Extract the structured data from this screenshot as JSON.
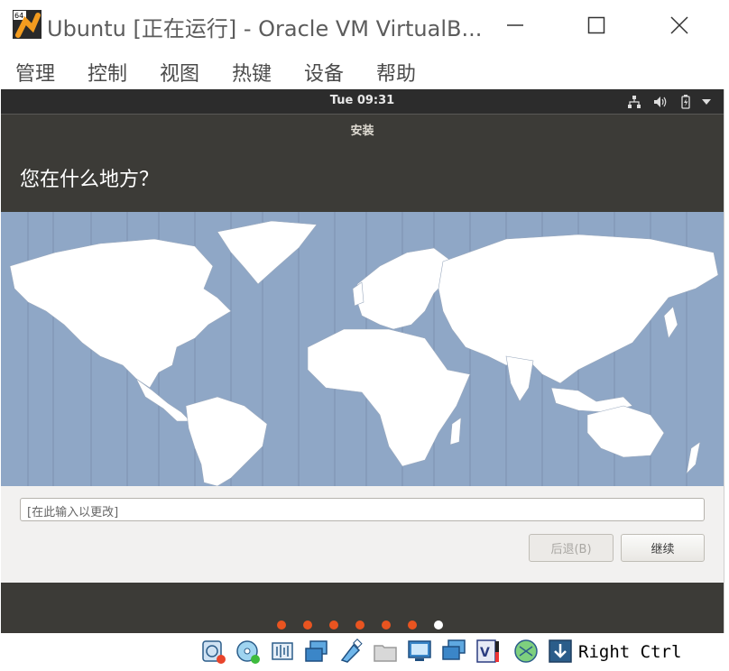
{
  "window": {
    "title": "Ubuntu [正在运行] - Oracle VM VirtualB...",
    "icon": "virtualbox-icon",
    "icon_badge": "64"
  },
  "menu": {
    "items": [
      "管理",
      "控制",
      "视图",
      "热键",
      "设备",
      "帮助"
    ]
  },
  "guest": {
    "clock": "Tue 09:31",
    "installer": {
      "title": "安装",
      "question": "您在什么地方？",
      "timezone_input": {
        "value": "[在此输入以更改]"
      },
      "back_label": "后退(B)",
      "next_label": "继续"
    },
    "progress": {
      "total": 7,
      "current": 7
    }
  },
  "statusbar": {
    "host_key": "Right Ctrl"
  },
  "colors": {
    "ubuntu_orange": "#e95420",
    "installer_dark": "#3c3b37",
    "map_ocean": "#8fa7c6"
  }
}
